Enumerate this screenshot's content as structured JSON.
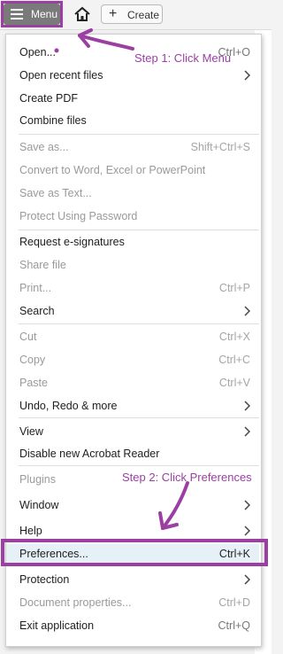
{
  "toolbar": {
    "menu_label": "Menu",
    "create_label": "Create"
  },
  "annotations": {
    "step1": "Step 1: Click Menu",
    "step2": "Step 2: Click Preferences",
    "color": "#9b3fa3"
  },
  "menu": {
    "open": {
      "label": "Open...",
      "shortcut": "Ctrl+O"
    },
    "open_recent": {
      "label": "Open recent files"
    },
    "create_pdf": {
      "label": "Create PDF"
    },
    "combine": {
      "label": "Combine files"
    },
    "save_as": {
      "label": "Save as...",
      "shortcut": "Shift+Ctrl+S"
    },
    "convert": {
      "label": "Convert to Word, Excel or PowerPoint"
    },
    "save_text": {
      "label": "Save as Text..."
    },
    "protect": {
      "label": "Protect Using Password"
    },
    "esign": {
      "label": "Request e-signatures"
    },
    "share": {
      "label": "Share file"
    },
    "print": {
      "label": "Print...",
      "shortcut": "Ctrl+P"
    },
    "search": {
      "label": "Search"
    },
    "cut": {
      "label": "Cut",
      "shortcut": "Ctrl+X"
    },
    "copy": {
      "label": "Copy",
      "shortcut": "Ctrl+C"
    },
    "paste": {
      "label": "Paste",
      "shortcut": "Ctrl+V"
    },
    "undo": {
      "label": "Undo, Redo & more"
    },
    "view": {
      "label": "View"
    },
    "disable": {
      "label": "Disable new Acrobat Reader"
    },
    "plugins": {
      "label": "Plugins"
    },
    "window": {
      "label": "Window"
    },
    "help": {
      "label": "Help"
    },
    "preferences": {
      "label": "Preferences...",
      "shortcut": "Ctrl+K"
    },
    "protection": {
      "label": "Protection"
    },
    "doc_props": {
      "label": "Document properties...",
      "shortcut": "Ctrl+D"
    },
    "exit": {
      "label": "Exit application",
      "shortcut": "Ctrl+Q"
    }
  }
}
